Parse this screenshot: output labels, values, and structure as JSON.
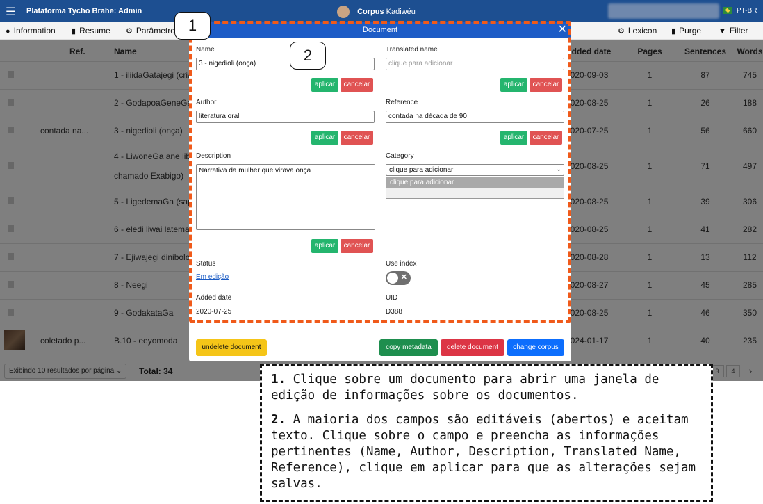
{
  "topbar": {
    "brand": "Plataforma Tycho Brahe: Admin",
    "corpus_label": "Corpus",
    "corpus_name": "Kadiwéu",
    "language": "PT-BR"
  },
  "toolbar": {
    "information": "Information",
    "resume": "Resume",
    "parametros": "Parâmetros",
    "lexicon": "Lexicon",
    "purge": "Purge",
    "filter": "Filter"
  },
  "table": {
    "headers": {
      "ref": "Ref.",
      "name": "Name",
      "added_date": "Added date",
      "pages": "Pages",
      "sentences": "Sentences",
      "words": "Words"
    },
    "rows": [
      {
        "ref": "",
        "name": "1 - iliidaGatajegi (criação...)",
        "date": "2020-09-03",
        "pages": "1",
        "sentences": "87",
        "words": "745"
      },
      {
        "ref": "",
        "name": "2 - GodapoaGeneGeo...",
        "date": "2020-08-25",
        "pages": "1",
        "sentences": "26",
        "words": "188"
      },
      {
        "ref": "contada na...",
        "name": "3 - nigedioli (onça)",
        "date": "2020-07-25",
        "pages": "1",
        "sentences": "56",
        "words": "660"
      },
      {
        "ref": "",
        "name": "4 - LiwoneGa ane libo...",
        "name2": "chamado Exabigo)",
        "date": "2020-08-25",
        "pages": "1",
        "sentences": "71",
        "words": "497"
      },
      {
        "ref": "",
        "name": "5 - LigedemaGa (sapo...)",
        "date": "2020-08-25",
        "pages": "1",
        "sentences": "39",
        "words": "306"
      },
      {
        "ref": "",
        "name": "6 - eledi liwai latemati...",
        "date": "2020-08-25",
        "pages": "1",
        "sentences": "41",
        "words": "282"
      },
      {
        "ref": "",
        "name": "7 - Ejiwajegi dinibolodo...",
        "date": "2020-08-28",
        "pages": "1",
        "sentences": "13",
        "words": "112"
      },
      {
        "ref": "",
        "name": "8 - Neegi",
        "date": "2020-08-27",
        "pages": "1",
        "sentences": "45",
        "words": "285"
      },
      {
        "ref": "",
        "name": "9 - GodakataGa",
        "date": "2020-08-25",
        "pages": "1",
        "sentences": "46",
        "words": "350"
      },
      {
        "ref": "coletado p...",
        "name": "B.10 - eeyomoda",
        "date": "2024-01-17",
        "pages": "1",
        "sentences": "40",
        "words": "235"
      }
    ]
  },
  "footer": {
    "per_page": "Exibindo 10 resultados por página",
    "total": "Total: 34",
    "page_3": "3",
    "page_4": "4",
    "next": "›"
  },
  "modal": {
    "title": "Document",
    "close": "✕",
    "name_label": "Name",
    "name_value": "3 - nigedioli (onça)",
    "translated_label": "Translated name",
    "translated_placeholder": "clique para adicionar",
    "author_label": "Author",
    "author_value": "literatura oral",
    "reference_label": "Reference",
    "reference_value": "contada na década de 90",
    "description_label": "Description",
    "description_value": "Narrativa da mulher que virava onça",
    "category_label": "Category",
    "category_selected": "clique para adicionar",
    "category_option": "clique para adicionar",
    "apply": "aplicar",
    "cancel": "cancelar",
    "status_label": "Status",
    "status_value": "Em edição",
    "use_index_label": "Use index",
    "use_index_on": false,
    "added_date_label": "Added date",
    "added_date_value": "2020-07-25",
    "uid_label": "UID",
    "uid_value": "D388",
    "undelete": "undelete document",
    "copy_metadata": "copy metadata",
    "delete": "delete document",
    "change_corpus": "change corpus"
  },
  "annotations": {
    "callout_1": "1",
    "callout_2": "2",
    "note_1_num": "1.",
    "note_1_text": " Clique sobre um documento para abrir uma janela de edição de informações sobre os documentos.",
    "note_2_num": "2.",
    "note_2_text": "  A maioria dos campos são editáveis (abertos) e aceitam texto. Clique sobre o campo e preencha as informações pertinentes (Name, Author, Description, Translated Name, Reference), clique em aplicar para que as alterações sejam salvas."
  },
  "colors": {
    "primary": "#1d5cc6",
    "apply": "#24b56e",
    "cancel": "#e05353",
    "undelete": "#f5c518",
    "copy": "#1e8e4e",
    "delete": "#dc3545",
    "change": "#0d6efd",
    "highlight": "#f05a1a"
  }
}
